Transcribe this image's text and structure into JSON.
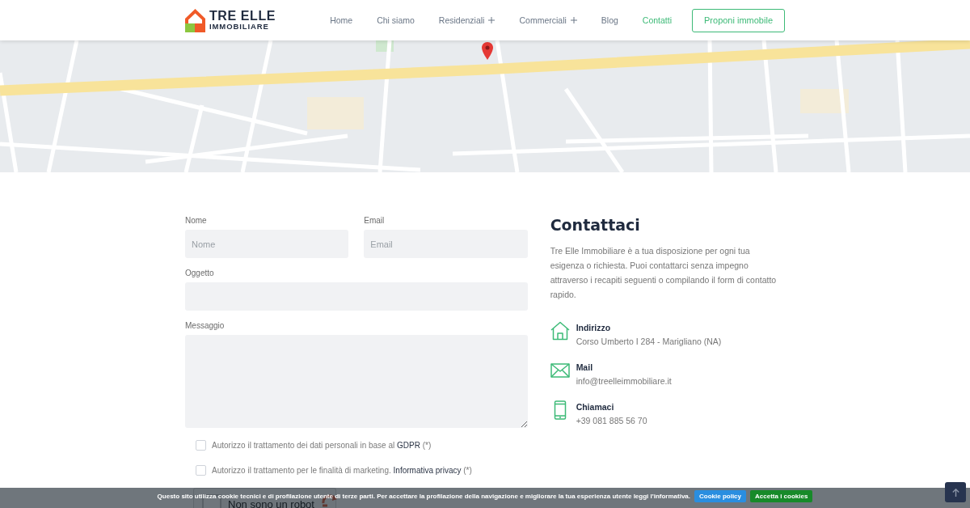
{
  "header": {
    "logo": {
      "title": "TRE ELLE",
      "subtitle": "IMMOBILIARE"
    },
    "nav": [
      {
        "label": "Home",
        "selected": false,
        "submenu": false
      },
      {
        "label": "Chi siamo",
        "selected": false,
        "submenu": false
      },
      {
        "label": "Residenziali",
        "selected": false,
        "submenu": true
      },
      {
        "label": "Commerciali",
        "selected": false,
        "submenu": true
      },
      {
        "label": "Blog",
        "selected": false,
        "submenu": false
      },
      {
        "label": "Contatti",
        "selected": true,
        "submenu": false
      }
    ],
    "cta": "Proponi immobile"
  },
  "form": {
    "fields": [
      {
        "label": "Nome",
        "placeholder": "Nome",
        "kind": "half"
      },
      {
        "label": "Email",
        "placeholder": "Email",
        "kind": "half"
      },
      {
        "label": "Oggetto",
        "kind": "full"
      },
      {
        "label": "Messaggio",
        "kind": "textarea"
      }
    ],
    "consents": [
      {
        "text": "Autorizzo il trattamento dei dati personali in base al ",
        "link": "GDPR",
        "suffix": " (*)",
        "checked": false
      },
      {
        "text": "Autorizzo il trattamento per le finalità di marketing. ",
        "link": "Informativa privacy",
        "suffix": " (*)",
        "checked": false
      }
    ],
    "captcha": {
      "label": "Non sono un robot",
      "checked": false
    }
  },
  "contact": {
    "title": "Contattaci",
    "intro": "Tre Elle Immobiliare è a tua disposizione per ogni tua esigenza o richiesta. Puoi contattarci senza impegno attraverso i recapiti seguenti o compilando il form di contatto rapido.",
    "items": [
      {
        "kind": "address",
        "title": "Indirizzo",
        "value": "Corso Umberto I 284 - Marigliano (NA)"
      },
      {
        "kind": "mail",
        "title": "Mail",
        "value": "info@treelleimmobiliare.it"
      },
      {
        "kind": "phone",
        "title": "Chiamaci",
        "value": "+39 081 885 56 70"
      }
    ]
  },
  "cookie_bar": {
    "text": "Questo sito utilizza cookie tecnici e di profilazione utente di terze parti. Per accettare la profilazione della navigazione e migliorare la tua esperienza utente leggi l'informativa.",
    "buttons": [
      {
        "label": "Cookie policy",
        "kind": "info"
      },
      {
        "label": "Accetta i cookies",
        "kind": "accept"
      }
    ]
  }
}
